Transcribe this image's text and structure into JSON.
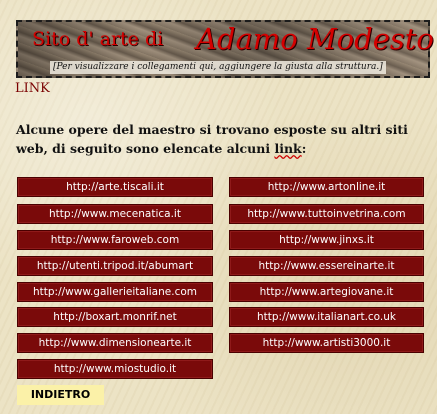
{
  "banner": {
    "title_prefix": "Sito d' arte di",
    "title_name": "Adamo Modesto",
    "subtitle": "[Per visualizzare i collegamenti qui, aggiungere la giusta alla struttura.]"
  },
  "section_label": "LINK",
  "intro": {
    "text_before": "Alcune opere del maestro si trovano esposte su altri siti web, di seguito sono elencate alcuni ",
    "link_word": "link",
    "text_after": ":"
  },
  "links_left": [
    "http://arte.tiscali.it",
    "http://www.mecenatica.it",
    "http://www.faroweb.com",
    "http://utenti.tripod.it/abumart",
    "http://www.gallerieitaliane.com",
    "http://boxart.monrif.net",
    "http://www.dimensionearte.it",
    "http://www.miostudio.it"
  ],
  "links_right": [
    "http://www.artonline.it",
    "http://www.tuttoinvetrina.com",
    "http://www.jinxs.it",
    "http://www.essereinarte.it",
    "http://www.artegiovane.it",
    "http://www.italianart.co.uk",
    "http://www.artisti3000.it"
  ],
  "back_label": "INDIETRO",
  "colors": {
    "button_bg": "#7a0a0a",
    "button_text": "#ffffff",
    "back_bg": "#fbf1a8",
    "title_red": "#d40000"
  }
}
